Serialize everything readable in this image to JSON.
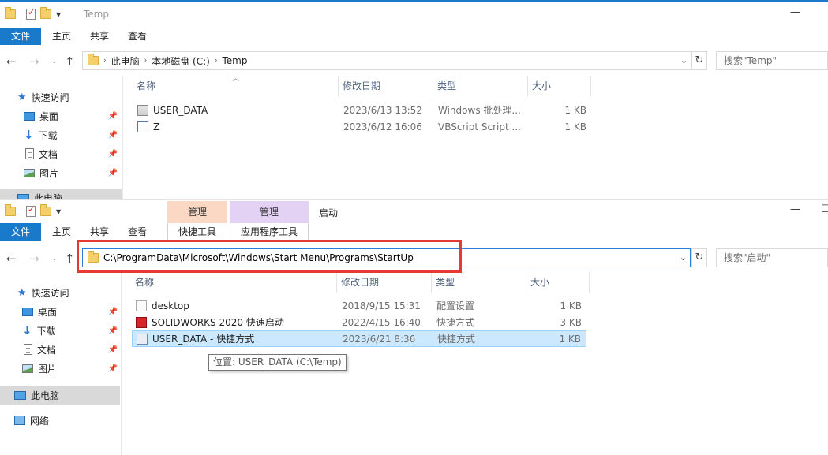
{
  "window1": {
    "title": "Temp",
    "tabs": [
      "文件",
      "主页",
      "共享",
      "查看"
    ],
    "breadcrumb": [
      "此电脑",
      "本地磁盘 (C:)",
      "Temp"
    ],
    "search_placeholder": "搜索\"Temp\"",
    "sidebar": {
      "quick_access": "快速访问",
      "items": [
        "桌面",
        "下载",
        "文档",
        "图片"
      ],
      "this_pc": "此电脑"
    },
    "columns": [
      "名称",
      "修改日期",
      "类型",
      "大小"
    ],
    "files": [
      {
        "name": "USER_DATA",
        "date": "2023/6/13 13:52",
        "type": "Windows 批处理...",
        "size": "1 KB",
        "icon": "batch-file-icon"
      },
      {
        "name": "Z",
        "date": "2023/6/12 16:06",
        "type": "VBScript Script ...",
        "size": "1 KB",
        "icon": "vbscript-file-icon"
      }
    ]
  },
  "window2": {
    "title": "启动",
    "tabs": [
      "文件",
      "主页",
      "共享",
      "查看"
    ],
    "context_groups": [
      {
        "header": "管理",
        "tab": "快捷工具",
        "color": "#fbd8c3"
      },
      {
        "header": "管理",
        "tab": "应用程序工具",
        "color": "#e4d2f5"
      }
    ],
    "address": "C:\\ProgramData\\Microsoft\\Windows\\Start Menu\\Programs\\StartUp",
    "search_placeholder": "搜索\"启动\"",
    "sidebar": {
      "quick_access": "快速访问",
      "items": [
        "桌面",
        "下载",
        "文档",
        "图片"
      ],
      "this_pc": "此电脑",
      "network": "网络"
    },
    "columns": [
      "名称",
      "修改日期",
      "类型",
      "大小"
    ],
    "files": [
      {
        "name": "desktop",
        "date": "2018/9/15 15:31",
        "type": "配置设置",
        "size": "1 KB",
        "icon": "settings-file-icon"
      },
      {
        "name": "SOLIDWORKS 2020 快速启动",
        "date": "2022/4/15 16:40",
        "type": "快捷方式",
        "size": "3 KB",
        "icon": "solidworks-icon"
      },
      {
        "name": "USER_DATA - 快捷方式",
        "date": "2023/6/21 8:36",
        "type": "快捷方式",
        "size": "1 KB",
        "icon": "shortcut-icon",
        "selected": true
      }
    ],
    "tooltip": "位置: USER_DATA (C:\\Temp)"
  },
  "colors": {
    "accent": "#1979ca",
    "highlight_box": "#e53935",
    "selection": "#cce8ff"
  }
}
